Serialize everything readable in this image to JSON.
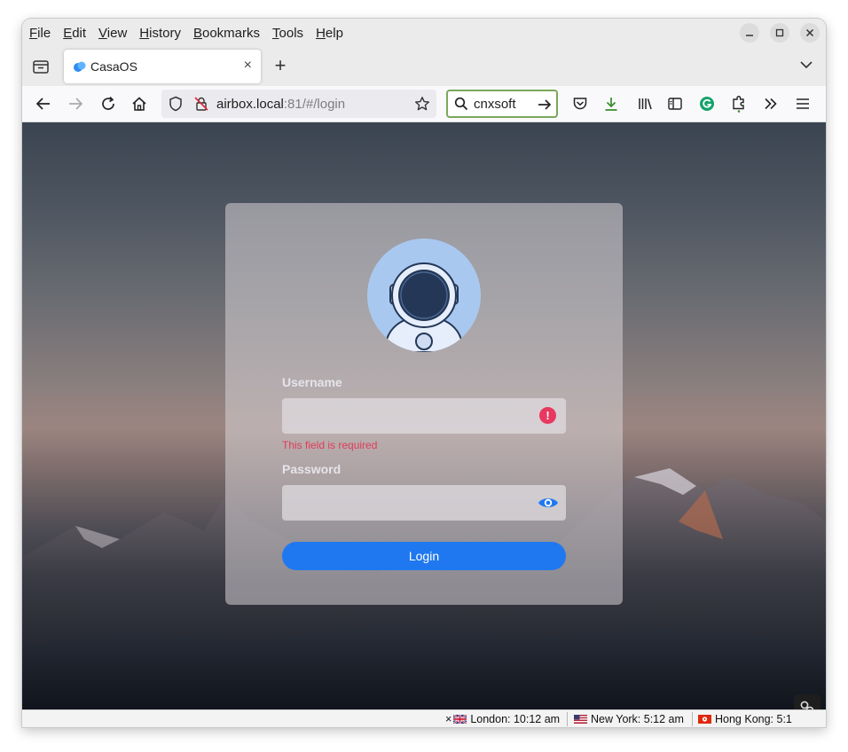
{
  "menu": {
    "items": [
      {
        "label": "File",
        "key": "F",
        "rest": "ile"
      },
      {
        "label": "Edit",
        "key": "E",
        "rest": "dit"
      },
      {
        "label": "View",
        "key": "V",
        "rest": "iew"
      },
      {
        "label": "History",
        "key": "H",
        "rest": "istory"
      },
      {
        "label": "Bookmarks",
        "key": "B",
        "rest": "ookmarks"
      },
      {
        "label": "Tools",
        "key": "T",
        "rest": "ools"
      },
      {
        "label": "Help",
        "key": "H",
        "rest": "elp"
      }
    ]
  },
  "tab": {
    "title": "CasaOS",
    "close": "×"
  },
  "new_tab": "+",
  "address": {
    "host": "airbox.local",
    "rest": ":81/#/login"
  },
  "search": {
    "value": "cnxsoft"
  },
  "login": {
    "username_label": "Username",
    "username_value": "",
    "username_error": "This field is required",
    "error_glyph": "!",
    "password_label": "Password",
    "password_value": "",
    "button_label": "Login"
  },
  "status": {
    "close_glyph": "×",
    "clocks": [
      {
        "label": "London: 10:12 am"
      },
      {
        "label": "New York: 5:12 am"
      },
      {
        "label": "Hong Kong: 5:1"
      }
    ]
  },
  "colors": {
    "accent": "#1f78f0",
    "error": "#e8385f",
    "avatar_bg": "#a9c8f0",
    "search_border": "#7aa85a"
  }
}
